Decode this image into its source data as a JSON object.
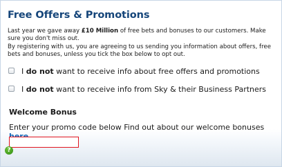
{
  "panel": {
    "title": "Free Offers & Promotions",
    "intro": {
      "before": "Last year we gave away ",
      "amount": "£10 Million",
      "after": " of free bets and bonuses to our customers. Make sure you don't miss out."
    },
    "consent_note": "By registering with us, you are agreeing to us sending you information about offers, free bets and bonuses, unless you tick the box below to opt out."
  },
  "opt_out": [
    {
      "checked": false,
      "prefix": "I ",
      "emphasis": "do not",
      "suffix": " want to receive info about free offers and promotions"
    },
    {
      "checked": false,
      "prefix": "I ",
      "emphasis": "do not",
      "suffix": " want to receive info from Sky & their Business Partners"
    }
  ],
  "welcome_bonus": {
    "heading": "Welcome Bonus",
    "promo_text": "Enter your promo code below Find out about our welcome bonuses ",
    "link_label": "here",
    "promo_code_value": ""
  },
  "icons": {
    "help": "question-mark-icon"
  },
  "colors": {
    "title": "#16467a",
    "link": "#1565b5",
    "input_error_border": "#e0141e",
    "help_icon": "#3c9a1c"
  }
}
